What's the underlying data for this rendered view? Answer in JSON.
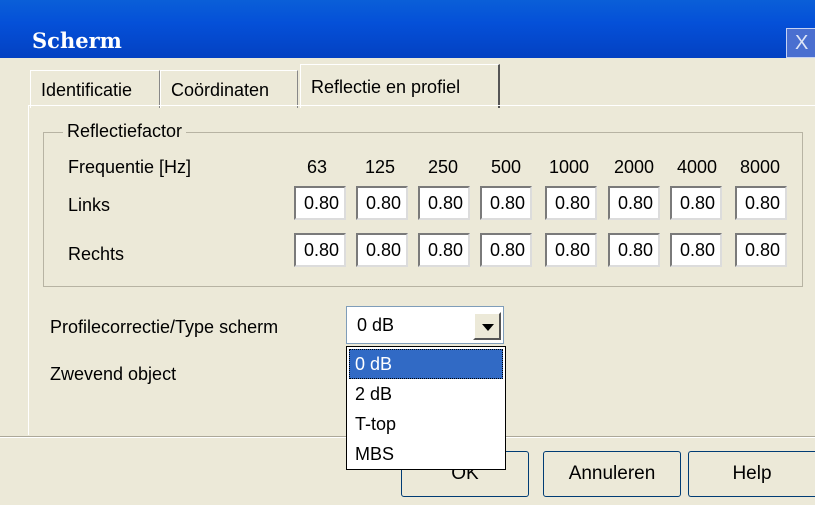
{
  "window": {
    "title": "Scherm",
    "close_glyph": "X"
  },
  "tabs": [
    {
      "label": "Identificatie"
    },
    {
      "label": "Coördinaten"
    },
    {
      "label": "Reflectie en profiel"
    }
  ],
  "reflection": {
    "group_label": "Reflectiefactor",
    "frequency_label": "Frequentie  [Hz]",
    "frequencies": [
      "63",
      "125",
      "250",
      "500",
      "1000",
      "2000",
      "4000",
      "8000"
    ],
    "left_label": "Links",
    "right_label": "Rechts",
    "left_values": [
      "0.80",
      "0.80",
      "0.80",
      "0.80",
      "0.80",
      "0.80",
      "0.80",
      "0.80"
    ],
    "right_values": [
      "0.80",
      "0.80",
      "0.80",
      "0.80",
      "0.80",
      "0.80",
      "0.80",
      "0.80"
    ]
  },
  "profile": {
    "label": "Profilecorrectie/Type scherm",
    "selected": "0 dB",
    "options": [
      "0 dB",
      "2 dB",
      "T-top",
      "MBS"
    ]
  },
  "floating_label": "Zwevend object",
  "buttons": {
    "ok": "OK",
    "cancel": "Annuleren",
    "help": "Help"
  },
  "colors": {
    "title_bar": "#0550d8",
    "selection": "#316ac5",
    "dialog_bg": "#ece9d8"
  }
}
